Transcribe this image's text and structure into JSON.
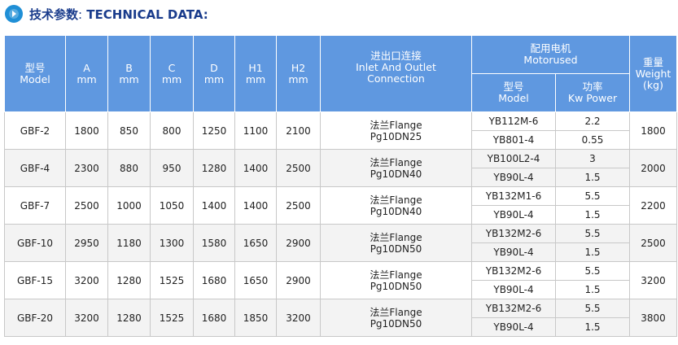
{
  "title": {
    "cn": "技术参数",
    "colon": ":",
    "en": " TECHNICAL DATA:"
  },
  "colors": {
    "header_bg": "#5f98e0",
    "title": "#1a3c8c",
    "icon": "#1f8fd6"
  },
  "headers": {
    "model": [
      "型号",
      "Model"
    ],
    "a": [
      "A",
      "mm"
    ],
    "b": [
      "B",
      "mm"
    ],
    "c": [
      "C",
      "mm"
    ],
    "d": [
      "D",
      "mm"
    ],
    "h1": [
      "H1",
      "mm"
    ],
    "h2": [
      "H2",
      "mm"
    ],
    "inlet": [
      "进出口连接",
      "Inlet And Outlet",
      "Connection"
    ],
    "motor": [
      "配用电机",
      "Motorused"
    ],
    "motor_model": [
      "型号",
      "Model"
    ],
    "power": [
      "功率",
      "Kw Power"
    ],
    "weight": [
      "重量",
      "Weight",
      "(kg)"
    ]
  },
  "rows": [
    {
      "model": "GBF-2",
      "a": "1800",
      "b": "850",
      "c": "800",
      "d": "1250",
      "h1": "1100",
      "h2": "2100",
      "inlet": [
        "法兰Flange",
        "Pg10DN25"
      ],
      "motors": [
        {
          "model": "YB112M-6",
          "power": "2.2"
        },
        {
          "model": "YB801-4",
          "power": "0.55"
        }
      ],
      "weight": "1800"
    },
    {
      "model": "GBF-4",
      "a": "2300",
      "b": "880",
      "c": "950",
      "d": "1280",
      "h1": "1400",
      "h2": "2500",
      "inlet": [
        "法兰Flange",
        "Pg10DN40"
      ],
      "motors": [
        {
          "model": "YB100L2-4",
          "power": "3"
        },
        {
          "model": "YB90L-4",
          "power": "1.5"
        }
      ],
      "weight": "2000"
    },
    {
      "model": "GBF-7",
      "a": "2500",
      "b": "1000",
      "c": "1050",
      "d": "1400",
      "h1": "1400",
      "h2": "2500",
      "inlet": [
        "法兰Flange",
        "Pg10DN40"
      ],
      "motors": [
        {
          "model": "YB132M1-6",
          "power": "5.5"
        },
        {
          "model": "YB90L-4",
          "power": "1.5"
        }
      ],
      "weight": "2200"
    },
    {
      "model": "GBF-10",
      "a": "2950",
      "b": "1180",
      "c": "1300",
      "d": "1580",
      "h1": "1650",
      "h2": "2900",
      "inlet": [
        "法兰Flange",
        "Pg10DN50"
      ],
      "motors": [
        {
          "model": "YB132M2-6",
          "power": "5.5"
        },
        {
          "model": "YB90L-4",
          "power": "1.5"
        }
      ],
      "weight": "2500"
    },
    {
      "model": "GBF-15",
      "a": "3200",
      "b": "1280",
      "c": "1525",
      "d": "1680",
      "h1": "1650",
      "h2": "2900",
      "inlet": [
        "法兰Flange",
        "Pg10DN50"
      ],
      "motors": [
        {
          "model": "YB132M2-6",
          "power": "5.5"
        },
        {
          "model": "YB90L-4",
          "power": "1.5"
        }
      ],
      "weight": "3200"
    },
    {
      "model": "GBF-20",
      "a": "3200",
      "b": "1280",
      "c": "1525",
      "d": "1680",
      "h1": "1850",
      "h2": "3200",
      "inlet": [
        "法兰Flange",
        "Pg10DN50"
      ],
      "motors": [
        {
          "model": "YB132M2-6",
          "power": "5.5"
        },
        {
          "model": "YB90L-4",
          "power": "1.5"
        }
      ],
      "weight": "3800"
    }
  ]
}
